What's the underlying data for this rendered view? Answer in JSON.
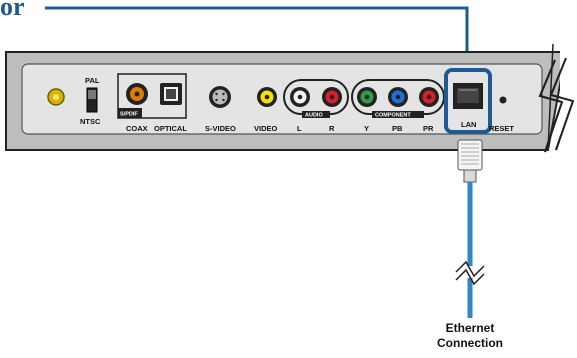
{
  "heading": {
    "text": "or"
  },
  "device": {
    "switch_top": "PAL",
    "switch_bottom": "NTSC",
    "spdif_label": "S/PDIF",
    "audio_group": "AUDIO",
    "component_group": "COMPONENT",
    "ports": {
      "coax": "COAX",
      "optical": "OPTICAL",
      "svideo": "S-VIDEO",
      "video": "VIDEO",
      "audio_l": "L",
      "audio_r": "R",
      "comp_y": "Y",
      "comp_pb": "PB",
      "comp_pr": "PR",
      "lan": "LAN",
      "reset": "RESET"
    }
  },
  "cable": {
    "caption_line1": "Ethernet",
    "caption_line2": "Connection"
  },
  "colors": {
    "highlight": "#1f5a92",
    "cable": "#2f86c8",
    "panel": "#e3e3e3"
  },
  "icons": [
    "power-connector-icon",
    "svideo-connector-icon",
    "ethernet-plug-icon",
    "break-symbol-icon"
  ]
}
